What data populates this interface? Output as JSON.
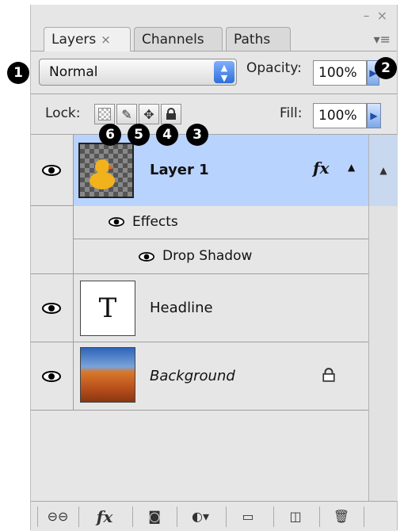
{
  "window": {
    "minimize": "–",
    "close": "×"
  },
  "tabs": [
    {
      "label": "Layers",
      "active": true,
      "close": "×"
    },
    {
      "label": "Channels",
      "active": false
    },
    {
      "label": "Paths",
      "active": false
    }
  ],
  "panel_menu_icon": "▾≡",
  "blend_mode": {
    "value": "Normal"
  },
  "opacity": {
    "label": "Opacity:",
    "value": "100%"
  },
  "lock": {
    "label": "Lock:",
    "icons": [
      "lock-transparent-pixels-icon",
      "lock-image-pixels-icon",
      "lock-position-icon",
      "lock-all-icon"
    ]
  },
  "fill": {
    "label": "Fill:",
    "value": "100%"
  },
  "callouts": [
    "1",
    "2",
    "3",
    "4",
    "5",
    "6"
  ],
  "layers": [
    {
      "name": "Layer 1",
      "selected": true,
      "fx": "fx",
      "effects_label": "Effects",
      "effect": "Drop Shadow"
    },
    {
      "name": "Headline",
      "thumb_text": "T"
    },
    {
      "name": "Background",
      "locked": true
    }
  ],
  "bottom_bar": {
    "buttons": [
      "link-layers-icon",
      "add-layer-style-icon",
      "add-layer-mask-icon",
      "new-adjustment-layer-icon",
      "new-group-icon",
      "new-layer-icon",
      "delete-layer-icon"
    ],
    "fx": "fx"
  },
  "colors": {
    "selection": "#b9d3ff",
    "accent": "#2f6fd8",
    "panel": "#e6e6e6"
  }
}
